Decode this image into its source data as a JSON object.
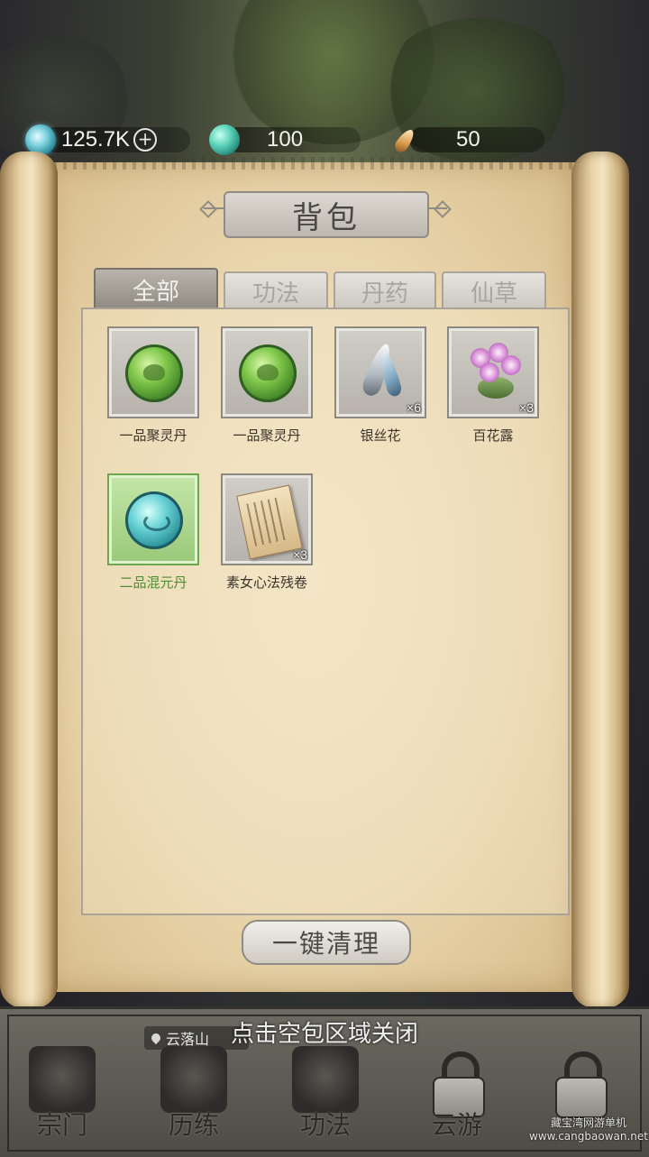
{
  "currencies": {
    "spirit_stone": {
      "value": "125.7K",
      "icon": "spirit-stone-icon",
      "action_icon": "plus-circle-icon"
    },
    "jade": {
      "value": "100",
      "icon": "jade-orb-icon"
    },
    "feather": {
      "value": "50",
      "icon": "feather-icon"
    }
  },
  "bag": {
    "title": "背包",
    "tabs": [
      {
        "label": "全部",
        "active": true
      },
      {
        "label": "功法",
        "active": false
      },
      {
        "label": "丹药",
        "active": false
      },
      {
        "label": "仙草",
        "active": false
      }
    ],
    "items": [
      {
        "name": "一品聚灵丹",
        "count": "",
        "icon": "green-pill-icon",
        "selected": false
      },
      {
        "name": "一品聚灵丹",
        "count": "",
        "icon": "green-pill-icon",
        "selected": false
      },
      {
        "name": "银丝花",
        "count": "×6",
        "icon": "silver-herb-icon",
        "selected": false
      },
      {
        "name": "百花露",
        "count": "×3",
        "icon": "purple-flower-icon",
        "selected": false
      },
      {
        "name": "二品混元丹",
        "count": "",
        "icon": "cyan-pill-icon",
        "selected": true
      },
      {
        "name": "素女心法残卷",
        "count": "×3",
        "icon": "scroll-fragment-icon",
        "selected": false
      }
    ],
    "clean_button": "一键清理",
    "colors": {
      "selected_label": "#4f8c33",
      "paper": "#ead6ad"
    }
  },
  "overlay": {
    "close_hint": "点击空包区域关闭",
    "location": "云落山"
  },
  "bottom_nav": [
    {
      "label": "宗门",
      "icon": "temple-icon",
      "locked": false
    },
    {
      "label": "历练",
      "icon": "sword-icon",
      "locked": false
    },
    {
      "label": "功法",
      "icon": "meditation-icon",
      "locked": false
    },
    {
      "label": "云游",
      "icon": "lock-icon",
      "locked": true
    },
    {
      "label": "",
      "icon": "lock-icon",
      "locked": true
    }
  ],
  "watermark": {
    "line1": "藏宝湾网游单机",
    "line2": "www.cangbaowan.net"
  }
}
